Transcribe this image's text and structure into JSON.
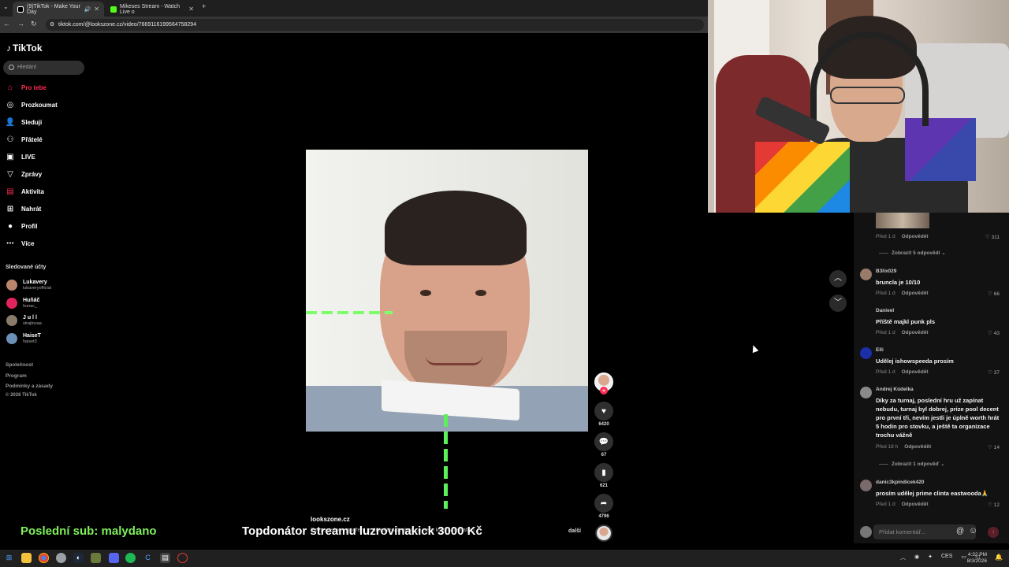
{
  "browser": {
    "tabs": [
      {
        "label": "(9)TikTok - Make Your Day",
        "active": true
      },
      {
        "label": "Mikeses Stream - Watch Live o",
        "active": false
      }
    ],
    "url": "tiktok.com/@lookszone.cz/video/7669116199564758294"
  },
  "sidebar": {
    "logo": "TikTok",
    "search_placeholder": "Hledání",
    "nav": [
      {
        "label": "Pro tebe",
        "icon": "home-icon",
        "active": true
      },
      {
        "label": "Prozkoumat",
        "icon": "compass-icon"
      },
      {
        "label": "Sleduji",
        "icon": "following-icon"
      },
      {
        "label": "Přátelé",
        "icon": "friends-icon"
      },
      {
        "label": "LIVE",
        "icon": "live-icon"
      },
      {
        "label": "Zprávy",
        "icon": "messages-icon"
      },
      {
        "label": "Aktivita",
        "icon": "activity-icon"
      },
      {
        "label": "Nahrát",
        "icon": "upload-icon"
      },
      {
        "label": "Profil",
        "icon": "profile-icon"
      },
      {
        "label": "Více",
        "icon": "more-icon"
      }
    ],
    "following_title": "Sledované účty",
    "following": [
      {
        "name": "Lukavery",
        "handle": "lukaveryofficial"
      },
      {
        "name": "Huňáč",
        "handle": "hunac_"
      },
      {
        "name": "J u l l",
        "handle": "strajtovaa"
      },
      {
        "name": "HaiseT",
        "handle": "haiset3"
      }
    ],
    "footer": [
      "Společnost",
      "Program",
      "Podmínky a zásady",
      "© 2026 TikTok"
    ]
  },
  "video": {
    "author": "lookszone.cz",
    "caption": "Pouze jedno vyjádření je důležité všechno co jsem kdy matematico...",
    "more_label": "další",
    "actions": {
      "likes": "6420",
      "comments": "67",
      "saves": "621",
      "shares": "4796"
    }
  },
  "comments": {
    "items": [
      {
        "user": "",
        "text": "",
        "time": "Před 1 d",
        "reply": "Odpovědět",
        "likes": "311"
      },
      {
        "user": "B3lix029",
        "text": "bruncla je 10/10",
        "time": "Před 1 d",
        "reply": "Odpovědět",
        "likes": "66"
      },
      {
        "user": "Danieel",
        "text": "Příště majkl punk pls",
        "time": "Před 1 d",
        "reply": "Odpovědět",
        "likes": "43"
      },
      {
        "user": "Elli",
        "text": "Udělej ishowspeeda prosím",
        "time": "Před 1 d",
        "reply": "Odpovědět",
        "likes": "37"
      },
      {
        "user": "Andrej Kúdelka",
        "text": "Díky za turnaj, poslední hru už zapínat nebudu, turnaj byl dobrej, prize pool decent pro první tři, nevím jestli je úplně worth hrát 5 hodin pro stovku, a ještě ta organizace trochu vážně",
        "time": "Před 18 h",
        "reply": "Odpovědět",
        "likes": "14"
      },
      {
        "user": "danic3kpindicek420",
        "text": "prosím udělej prime clinta eastwooda🙏",
        "time": "Před 1 d",
        "reply": "Odpovědět",
        "likes": "12"
      }
    ],
    "show_replies_5": "Zobrazit 5 odpovědí",
    "show_replies_1": "Zobrazit 1 odpověď",
    "input_placeholder": "Přidat komentář..."
  },
  "overlay": {
    "last_sub": "Poslední sub: malydano",
    "top_donor": "Topdonátor streamu luzrovinakick  3000 Kč"
  },
  "taskbar": {
    "lang": "CES",
    "time": "4:32 PM",
    "date": "8/3/2026"
  },
  "colors": {
    "accent": "#fe2c55",
    "overlay_green": "#7ff05a"
  }
}
